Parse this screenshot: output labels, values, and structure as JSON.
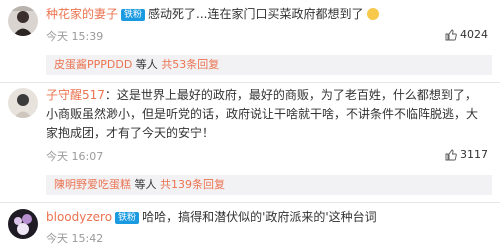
{
  "comments": [
    {
      "username": "种花家的妻子",
      "badge": "铁粉",
      "text": "感动死了...连在家门口买菜政府都想到了",
      "time": "今天 15:39",
      "likes": "4024",
      "reply": {
        "name": "皮蛋酱PPPDDD",
        "suffix": " 等人 ",
        "count": "共53条回复"
      }
    },
    {
      "username": "子守醒517",
      "text": "：这是世界上最好的政府，最好的商贩，为了老百姓，什么都想到了，小商贩虽然渺小，但是听党的话，政府说让干啥就干啥，不讲条件不临阵脱逃，大家抱成团，才有了今天的安宁！",
      "time": "今天 16:07",
      "likes": "3117",
      "reply": {
        "name": "陳明野爱吃蛋糕",
        "suffix": " 等人 ",
        "count": "共139条回复"
      }
    },
    {
      "username": "bloodyzero",
      "badge": "铁粉",
      "text": "哈哈，搞得和潜伏似的'政府派来的'这种台词",
      "time": "今天 15:42"
    }
  ],
  "colors": {
    "username": "#eb7350",
    "badge": "#1a9ae0",
    "reply_bg": "#f2f2f5"
  },
  "icons": [
    "avatar",
    "badge",
    "emoji-icon",
    "like-icon"
  ]
}
